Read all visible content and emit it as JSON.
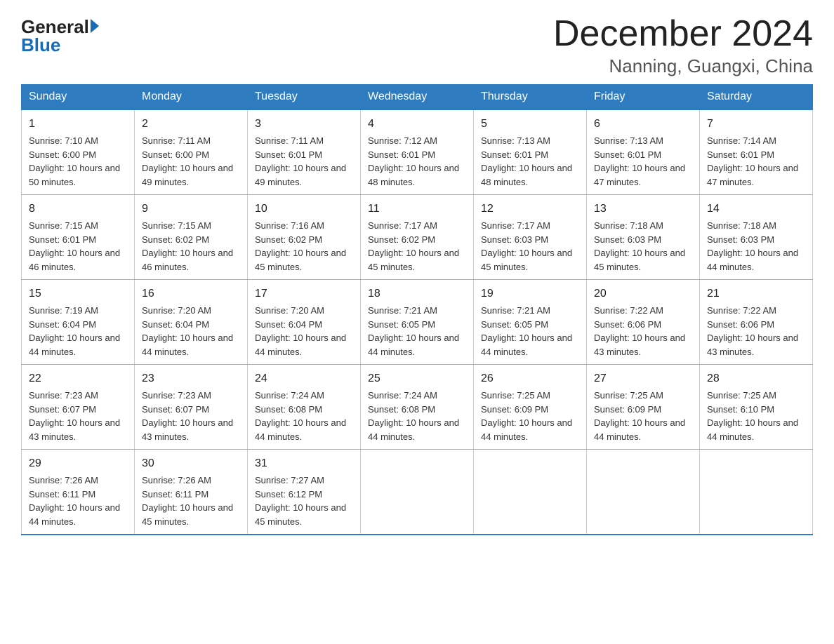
{
  "header": {
    "logo": {
      "general": "General",
      "blue": "Blue"
    },
    "title": "December 2024",
    "location": "Nanning, Guangxi, China"
  },
  "days_of_week": [
    "Sunday",
    "Monday",
    "Tuesday",
    "Wednesday",
    "Thursday",
    "Friday",
    "Saturday"
  ],
  "weeks": [
    [
      {
        "day": "1",
        "sunrise": "7:10 AM",
        "sunset": "6:00 PM",
        "daylight": "10 hours and 50 minutes."
      },
      {
        "day": "2",
        "sunrise": "7:11 AM",
        "sunset": "6:00 PM",
        "daylight": "10 hours and 49 minutes."
      },
      {
        "day": "3",
        "sunrise": "7:11 AM",
        "sunset": "6:01 PM",
        "daylight": "10 hours and 49 minutes."
      },
      {
        "day": "4",
        "sunrise": "7:12 AM",
        "sunset": "6:01 PM",
        "daylight": "10 hours and 48 minutes."
      },
      {
        "day": "5",
        "sunrise": "7:13 AM",
        "sunset": "6:01 PM",
        "daylight": "10 hours and 48 minutes."
      },
      {
        "day": "6",
        "sunrise": "7:13 AM",
        "sunset": "6:01 PM",
        "daylight": "10 hours and 47 minutes."
      },
      {
        "day": "7",
        "sunrise": "7:14 AM",
        "sunset": "6:01 PM",
        "daylight": "10 hours and 47 minutes."
      }
    ],
    [
      {
        "day": "8",
        "sunrise": "7:15 AM",
        "sunset": "6:01 PM",
        "daylight": "10 hours and 46 minutes."
      },
      {
        "day": "9",
        "sunrise": "7:15 AM",
        "sunset": "6:02 PM",
        "daylight": "10 hours and 46 minutes."
      },
      {
        "day": "10",
        "sunrise": "7:16 AM",
        "sunset": "6:02 PM",
        "daylight": "10 hours and 45 minutes."
      },
      {
        "day": "11",
        "sunrise": "7:17 AM",
        "sunset": "6:02 PM",
        "daylight": "10 hours and 45 minutes."
      },
      {
        "day": "12",
        "sunrise": "7:17 AM",
        "sunset": "6:03 PM",
        "daylight": "10 hours and 45 minutes."
      },
      {
        "day": "13",
        "sunrise": "7:18 AM",
        "sunset": "6:03 PM",
        "daylight": "10 hours and 45 minutes."
      },
      {
        "day": "14",
        "sunrise": "7:18 AM",
        "sunset": "6:03 PM",
        "daylight": "10 hours and 44 minutes."
      }
    ],
    [
      {
        "day": "15",
        "sunrise": "7:19 AM",
        "sunset": "6:04 PM",
        "daylight": "10 hours and 44 minutes."
      },
      {
        "day": "16",
        "sunrise": "7:20 AM",
        "sunset": "6:04 PM",
        "daylight": "10 hours and 44 minutes."
      },
      {
        "day": "17",
        "sunrise": "7:20 AM",
        "sunset": "6:04 PM",
        "daylight": "10 hours and 44 minutes."
      },
      {
        "day": "18",
        "sunrise": "7:21 AM",
        "sunset": "6:05 PM",
        "daylight": "10 hours and 44 minutes."
      },
      {
        "day": "19",
        "sunrise": "7:21 AM",
        "sunset": "6:05 PM",
        "daylight": "10 hours and 44 minutes."
      },
      {
        "day": "20",
        "sunrise": "7:22 AM",
        "sunset": "6:06 PM",
        "daylight": "10 hours and 43 minutes."
      },
      {
        "day": "21",
        "sunrise": "7:22 AM",
        "sunset": "6:06 PM",
        "daylight": "10 hours and 43 minutes."
      }
    ],
    [
      {
        "day": "22",
        "sunrise": "7:23 AM",
        "sunset": "6:07 PM",
        "daylight": "10 hours and 43 minutes."
      },
      {
        "day": "23",
        "sunrise": "7:23 AM",
        "sunset": "6:07 PM",
        "daylight": "10 hours and 43 minutes."
      },
      {
        "day": "24",
        "sunrise": "7:24 AM",
        "sunset": "6:08 PM",
        "daylight": "10 hours and 44 minutes."
      },
      {
        "day": "25",
        "sunrise": "7:24 AM",
        "sunset": "6:08 PM",
        "daylight": "10 hours and 44 minutes."
      },
      {
        "day": "26",
        "sunrise": "7:25 AM",
        "sunset": "6:09 PM",
        "daylight": "10 hours and 44 minutes."
      },
      {
        "day": "27",
        "sunrise": "7:25 AM",
        "sunset": "6:09 PM",
        "daylight": "10 hours and 44 minutes."
      },
      {
        "day": "28",
        "sunrise": "7:25 AM",
        "sunset": "6:10 PM",
        "daylight": "10 hours and 44 minutes."
      }
    ],
    [
      {
        "day": "29",
        "sunrise": "7:26 AM",
        "sunset": "6:11 PM",
        "daylight": "10 hours and 44 minutes."
      },
      {
        "day": "30",
        "sunrise": "7:26 AM",
        "sunset": "6:11 PM",
        "daylight": "10 hours and 45 minutes."
      },
      {
        "day": "31",
        "sunrise": "7:27 AM",
        "sunset": "6:12 PM",
        "daylight": "10 hours and 45 minutes."
      },
      null,
      null,
      null,
      null
    ]
  ],
  "labels": {
    "sunrise": "Sunrise: ",
    "sunset": "Sunset: ",
    "daylight": "Daylight: "
  }
}
